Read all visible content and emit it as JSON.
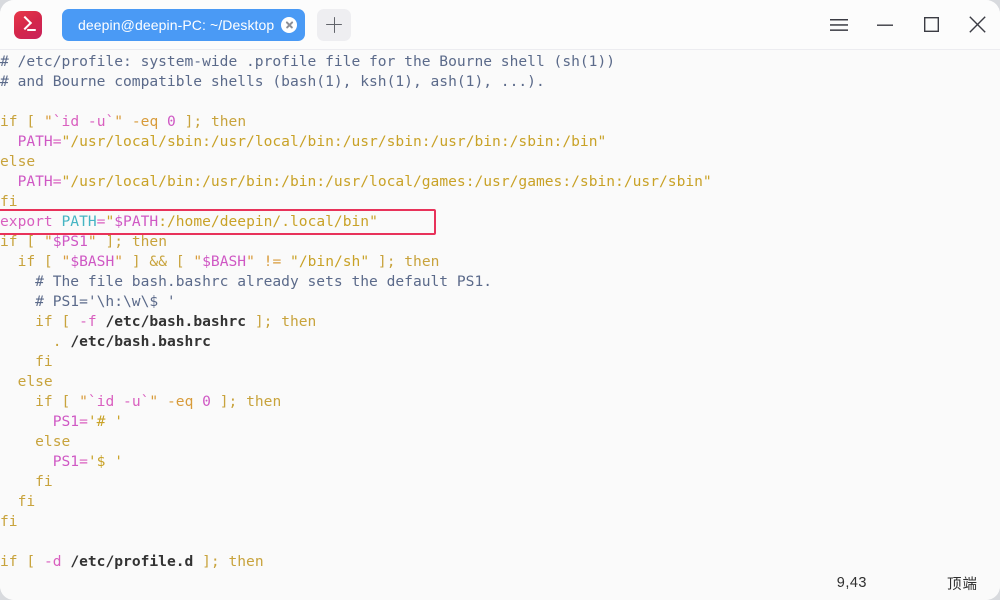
{
  "window": {
    "app_icon": "terminal-prompt-icon",
    "accent_color": "#4a9af5",
    "background": "#fafafa"
  },
  "titlebar": {
    "tab": {
      "title": "deepin@deepin-PC: ~/Desktop",
      "close_icon": "close-icon"
    },
    "new_tab_icon": "plus-icon",
    "controls": [
      {
        "name": "menu-button",
        "icon": "hamburger-menu-icon"
      },
      {
        "name": "minimize-button",
        "icon": "minimize-icon"
      },
      {
        "name": "maximize-button",
        "icon": "maximize-icon"
      },
      {
        "name": "close-button",
        "icon": "close-icon"
      }
    ]
  },
  "editor": {
    "highlight_color": "#e8325a",
    "highlighted_line_index": 8,
    "lines": [
      {
        "i": 0,
        "segs": [
          {
            "t": "# /etc/profile: system-wide .profile file for the Bourne shell (sh(1))",
            "c": "c-comment"
          }
        ]
      },
      {
        "i": 1,
        "segs": [
          {
            "t": "# and Bourne compatible shells (bash(1), ksh(1), ash(1), ...).",
            "c": "c-comment"
          }
        ]
      },
      {
        "i": 2,
        "segs": [
          {
            "t": "",
            "c": "c-plain"
          }
        ]
      },
      {
        "i": 3,
        "segs": [
          {
            "t": "if [ ",
            "c": "c-kw"
          },
          {
            "t": "\"",
            "c": "c-orange"
          },
          {
            "t": "`",
            "c": "c-op"
          },
          {
            "t": "id",
            "c": "c-op"
          },
          {
            "t": " ",
            "c": "c-plain"
          },
          {
            "t": "-u",
            "c": "c-flag"
          },
          {
            "t": "`",
            "c": "c-op"
          },
          {
            "t": "\"",
            "c": "c-orange"
          },
          {
            "t": " ",
            "c": "c-plain"
          },
          {
            "t": "-eq",
            "c": "c-orange"
          },
          {
            "t": " ",
            "c": "c-plain"
          },
          {
            "t": "0",
            "c": "c-num"
          },
          {
            "t": " ]; then",
            "c": "c-kw"
          }
        ]
      },
      {
        "i": 4,
        "segs": [
          {
            "t": "  ",
            "c": "c-plain"
          },
          {
            "t": "PATH",
            "c": "c-var"
          },
          {
            "t": "=",
            "c": "c-eqs"
          },
          {
            "t": "\"/usr/local/sbin:/usr/local/bin:/usr/sbin:/usr/bin:/sbin:/bin\"",
            "c": "c-str"
          }
        ]
      },
      {
        "i": 5,
        "segs": [
          {
            "t": "else",
            "c": "c-kw"
          }
        ]
      },
      {
        "i": 6,
        "segs": [
          {
            "t": "  ",
            "c": "c-plain"
          },
          {
            "t": "PATH",
            "c": "c-var"
          },
          {
            "t": "=",
            "c": "c-eqs"
          },
          {
            "t": "\"/usr/local/bin:/usr/bin:/bin:/usr/local/games:/usr/games:/sbin:/usr/sbin\"",
            "c": "c-str"
          }
        ]
      },
      {
        "i": 7,
        "segs": [
          {
            "t": "fi",
            "c": "c-kw"
          }
        ]
      },
      {
        "i": 8,
        "segs": [
          {
            "t": "export",
            "c": "c-op"
          },
          {
            "t": " ",
            "c": "c-plain"
          },
          {
            "t": "PATH",
            "c": "c-teal"
          },
          {
            "t": "=",
            "c": "c-eqs"
          },
          {
            "t": "\"",
            "c": "c-str"
          },
          {
            "t": "$PATH",
            "c": "c-var"
          },
          {
            "t": ":/home/deepin/.local/bin\"",
            "c": "c-str"
          }
        ]
      },
      {
        "i": 9,
        "segs": [
          {
            "t": "if [ ",
            "c": "c-kw"
          },
          {
            "t": "\"",
            "c": "c-orange"
          },
          {
            "t": "$PS1",
            "c": "c-var"
          },
          {
            "t": "\"",
            "c": "c-orange"
          },
          {
            "t": " ]; then",
            "c": "c-kw"
          }
        ]
      },
      {
        "i": 10,
        "segs": [
          {
            "t": "  if [ ",
            "c": "c-kw"
          },
          {
            "t": "\"",
            "c": "c-orange"
          },
          {
            "t": "$BASH",
            "c": "c-var"
          },
          {
            "t": "\"",
            "c": "c-orange"
          },
          {
            "t": " ] && [ ",
            "c": "c-kw"
          },
          {
            "t": "\"",
            "c": "c-orange"
          },
          {
            "t": "$BASH",
            "c": "c-var"
          },
          {
            "t": "\"",
            "c": "c-orange"
          },
          {
            "t": " ",
            "c": "c-plain"
          },
          {
            "t": "!=",
            "c": "c-orange"
          },
          {
            "t": " ",
            "c": "c-plain"
          },
          {
            "t": "\"/bin/sh\"",
            "c": "c-str"
          },
          {
            "t": " ]; then",
            "c": "c-kw"
          }
        ]
      },
      {
        "i": 11,
        "segs": [
          {
            "t": "    # The file bash.bashrc already sets the default PS1.",
            "c": "c-comment"
          }
        ]
      },
      {
        "i": 12,
        "segs": [
          {
            "t": "    # PS1='\\h:\\w\\$ '",
            "c": "c-comment"
          }
        ]
      },
      {
        "i": 13,
        "segs": [
          {
            "t": "    if [ ",
            "c": "c-kw"
          },
          {
            "t": "-f",
            "c": "c-flag"
          },
          {
            "t": " ",
            "c": "c-plain"
          },
          {
            "t": "/etc/bash.bashrc",
            "c": "c-path"
          },
          {
            "t": " ]; then",
            "c": "c-kw"
          }
        ]
      },
      {
        "i": 14,
        "segs": [
          {
            "t": "      ",
            "c": "c-plain"
          },
          {
            "t": ".",
            "c": "c-kw"
          },
          {
            "t": " ",
            "c": "c-plain"
          },
          {
            "t": "/etc/bash.bashrc",
            "c": "c-path"
          }
        ]
      },
      {
        "i": 15,
        "segs": [
          {
            "t": "    fi",
            "c": "c-kw"
          }
        ]
      },
      {
        "i": 16,
        "segs": [
          {
            "t": "  else",
            "c": "c-kw"
          }
        ]
      },
      {
        "i": 17,
        "segs": [
          {
            "t": "    if [ ",
            "c": "c-kw"
          },
          {
            "t": "\"",
            "c": "c-orange"
          },
          {
            "t": "`",
            "c": "c-op"
          },
          {
            "t": "id",
            "c": "c-op"
          },
          {
            "t": " ",
            "c": "c-plain"
          },
          {
            "t": "-u",
            "c": "c-flag"
          },
          {
            "t": "`",
            "c": "c-op"
          },
          {
            "t": "\"",
            "c": "c-orange"
          },
          {
            "t": " ",
            "c": "c-plain"
          },
          {
            "t": "-eq",
            "c": "c-orange"
          },
          {
            "t": " ",
            "c": "c-plain"
          },
          {
            "t": "0",
            "c": "c-num"
          },
          {
            "t": " ]; then",
            "c": "c-kw"
          }
        ]
      },
      {
        "i": 18,
        "segs": [
          {
            "t": "      ",
            "c": "c-plain"
          },
          {
            "t": "PS1",
            "c": "c-var"
          },
          {
            "t": "=",
            "c": "c-eqs"
          },
          {
            "t": "'# '",
            "c": "c-str"
          }
        ]
      },
      {
        "i": 19,
        "segs": [
          {
            "t": "    else",
            "c": "c-kw"
          }
        ]
      },
      {
        "i": 20,
        "segs": [
          {
            "t": "      ",
            "c": "c-plain"
          },
          {
            "t": "PS1",
            "c": "c-var"
          },
          {
            "t": "=",
            "c": "c-eqs"
          },
          {
            "t": "'$ '",
            "c": "c-str"
          }
        ]
      },
      {
        "i": 21,
        "segs": [
          {
            "t": "    fi",
            "c": "c-kw"
          }
        ]
      },
      {
        "i": 22,
        "segs": [
          {
            "t": "  fi",
            "c": "c-kw"
          }
        ]
      },
      {
        "i": 23,
        "segs": [
          {
            "t": "fi",
            "c": "c-kw"
          }
        ]
      },
      {
        "i": 24,
        "segs": [
          {
            "t": "",
            "c": "c-plain"
          }
        ]
      },
      {
        "i": 25,
        "segs": [
          {
            "t": "if [ ",
            "c": "c-kw"
          },
          {
            "t": "-d",
            "c": "c-flag"
          },
          {
            "t": " ",
            "c": "c-plain"
          },
          {
            "t": "/etc/profile.d",
            "c": "c-path"
          },
          {
            "t": " ]; then",
            "c": "c-kw"
          }
        ]
      }
    ]
  },
  "statusbar": {
    "cursor_position": "9,43",
    "scroll_position": "顶端"
  }
}
